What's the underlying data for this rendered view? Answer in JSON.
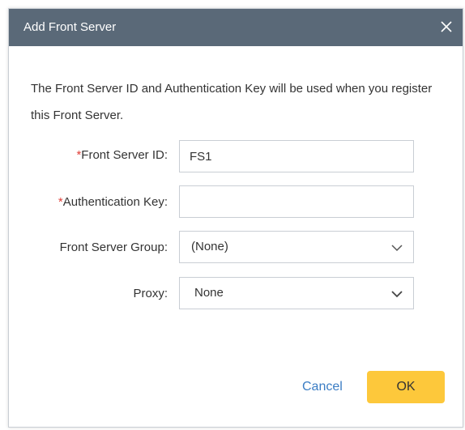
{
  "dialog": {
    "title": "Add Front Server",
    "description": "The Front Server ID and Authentication Key will be used when you register this Front Server."
  },
  "form": {
    "required_marker": "*",
    "front_server_id": {
      "label": "Front Server ID:",
      "value": "FS1"
    },
    "authentication_key": {
      "label": "Authentication Key:",
      "value": ""
    },
    "front_server_group": {
      "label": "Front Server Group:",
      "selected": "(None)"
    },
    "proxy": {
      "label": "Proxy:",
      "selected": "None"
    }
  },
  "buttons": {
    "cancel": "Cancel",
    "ok": "OK"
  },
  "colors": {
    "titlebar": "#5a6978",
    "required": "#e0403a",
    "link": "#3b7dc4",
    "primary_button": "#fdc83b"
  },
  "icons": {
    "close": "close-icon",
    "dropdown": "chevron-down-icon"
  }
}
